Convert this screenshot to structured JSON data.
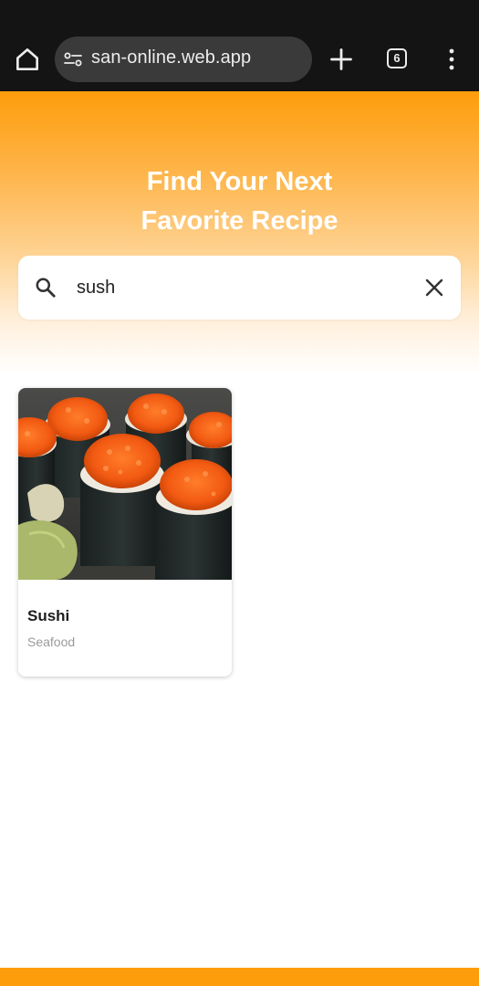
{
  "browser": {
    "url": "san-online.web.app",
    "tab_count": "6",
    "icons": [
      "home-icon",
      "site-info-icon",
      "plus-icon",
      "tab-switcher-icon",
      "more-vert-icon"
    ],
    "bar_color": "#141414"
  },
  "hero": {
    "title_line1": "Find Your Next",
    "title_line2": "Favorite Recipe"
  },
  "search": {
    "value": "sush",
    "icons": [
      "search-icon",
      "close-icon"
    ]
  },
  "results": [
    {
      "name": "Sushi",
      "category": "Seafood",
      "image": "sushi-photo"
    }
  ],
  "colors": {
    "accent": "#fe9d0c",
    "card_background": "#ffffff",
    "title_text": "#1d1d1d",
    "muted_text": "#9a9a9a"
  }
}
